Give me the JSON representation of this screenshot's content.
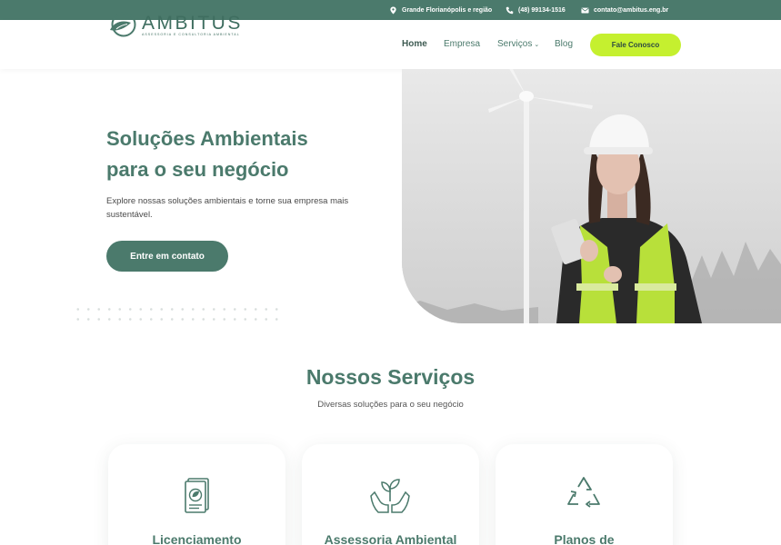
{
  "topbar": {
    "location": "Grande Florianópolis e região",
    "phone": "(48) 99134-1516",
    "email": "contato@ambitus.eng.br",
    "icons": [
      "location-pin-icon",
      "phone-icon",
      "mail-icon"
    ]
  },
  "header": {
    "logo_name": "AMBITUS",
    "logo_tagline": "ASSESSORIA E CONSULTORIA AMBIENTAL",
    "nav": {
      "home": "Home",
      "empresa": "Empresa",
      "servicos": "Serviços",
      "blog": "Blog"
    },
    "cta": "Fale Conosco"
  },
  "hero": {
    "title_line1": "Soluções Ambientais",
    "title_line2": "para o seu negócio",
    "subtitle": "Explore nossas soluções ambientais e torne sua empresa mais sustentável.",
    "button": "Entre em contato",
    "image": "engineer-with-wind-turbine-photo"
  },
  "services": {
    "title": "Nossos Serviços",
    "subtitle": "Diversas soluções para o seu negócio",
    "cards": [
      {
        "title": "Licenciamento",
        "icon": "document-leaf-icon"
      },
      {
        "title": "Assessoria Ambiental",
        "icon": "hands-plant-icon"
      },
      {
        "title": "Planos de",
        "icon": "recycle-icon"
      }
    ]
  },
  "colors": {
    "primary": "#4b7a6c",
    "accent": "#c5f02f",
    "text": "#4a4a4a",
    "background": "#ffffff"
  }
}
